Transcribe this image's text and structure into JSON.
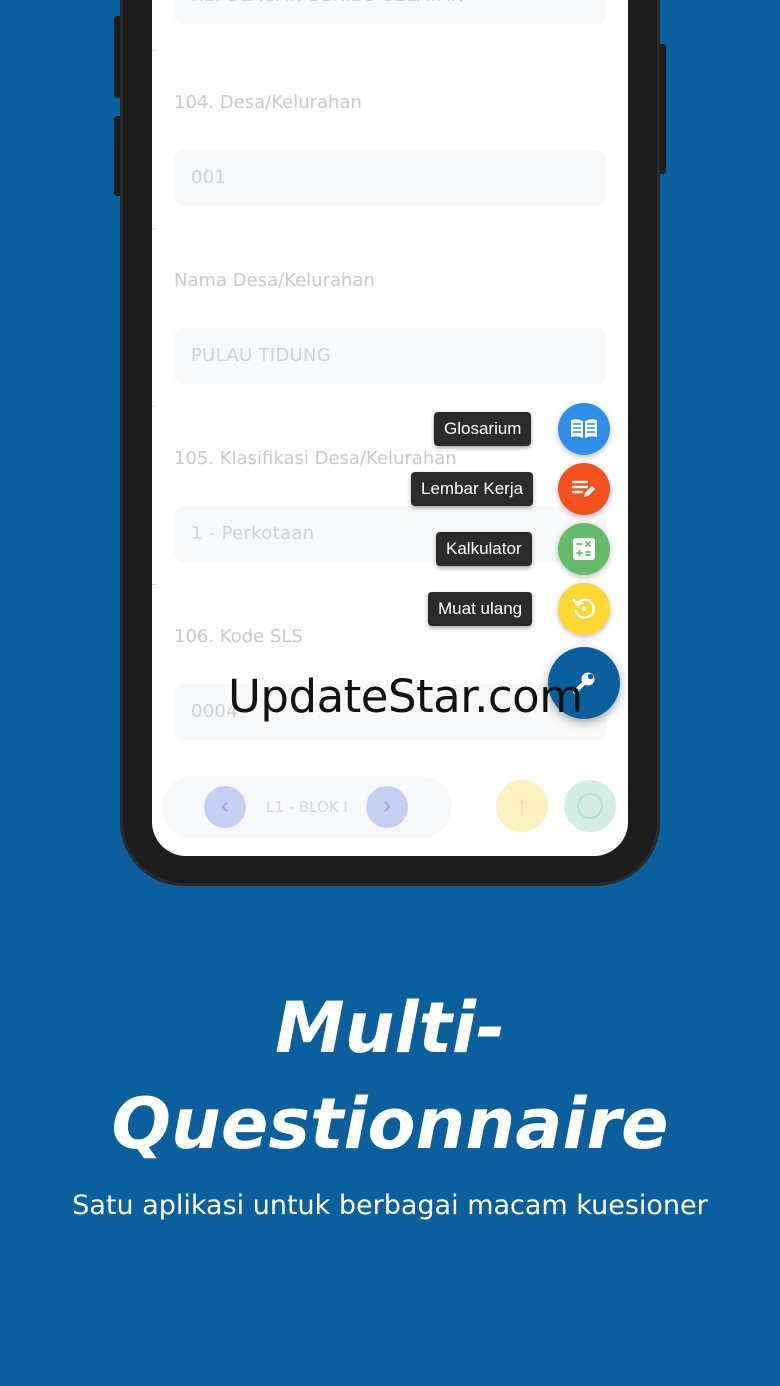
{
  "form": {
    "field_top_value": "KEPULAUAN SERIBU SELATAN",
    "desa_label": "104. Desa/Kelurahan",
    "desa_value": "001",
    "nama_desa_label": "Nama Desa/Kelurahan",
    "nama_desa_value": "PULAU TIDUNG",
    "klasifikasi_label": "105. Klasifikasi Desa/Kelurahan",
    "klasifikasi_value": "1 - Perkotaan",
    "kode_sls_label": "106. Kode SLS",
    "kode_sls_value": "0004"
  },
  "nav": {
    "prev_glyph": "‹",
    "section_label": "L1 - BLOK I",
    "next_glyph": "›",
    "up_glyph": "↑"
  },
  "fab_menu": {
    "items": [
      {
        "label": "Glosarium",
        "icon": "book-icon",
        "color": "#2f8fe8"
      },
      {
        "label": "Lembar Kerja",
        "icon": "notes-edit-icon",
        "color": "#f4511e"
      },
      {
        "label": "Kalkulator",
        "icon": "calculator-icon",
        "color": "#66bb6a"
      },
      {
        "label": "Muat ulang",
        "icon": "reload-icon",
        "color": "#fdd835"
      }
    ],
    "main_icon": "wrench-icon",
    "main_color": "#0a5f9c"
  },
  "watermark": "UpdateStar.com",
  "promo": {
    "title_line1": "Multi-",
    "title_line2": "Questionnaire",
    "subtitle": "Satu aplikasi untuk berbagai macam kuesioner"
  },
  "colors": {
    "background": "#0a5f9c"
  }
}
